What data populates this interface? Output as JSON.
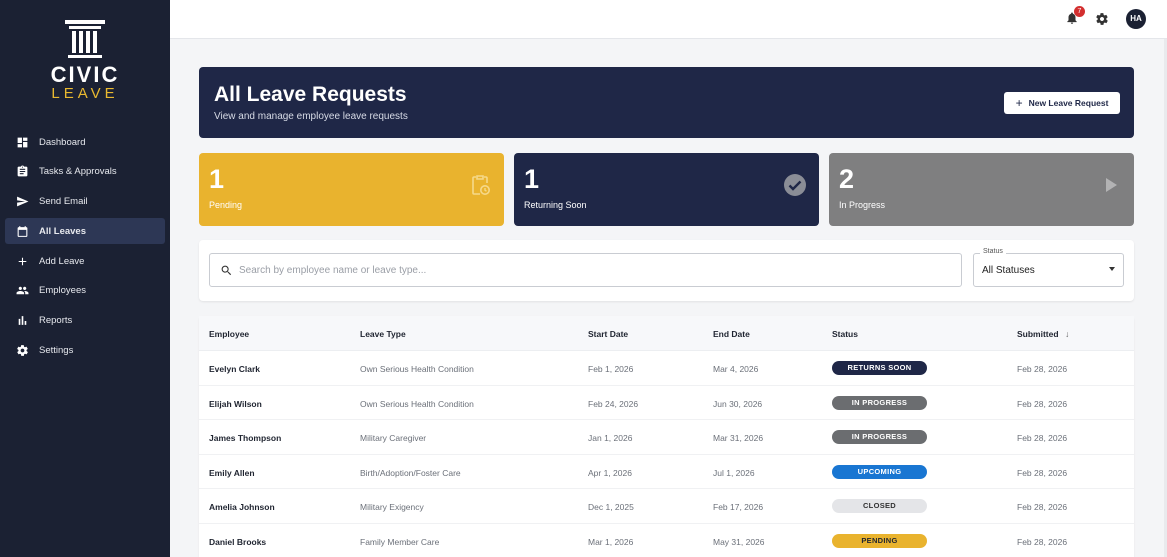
{
  "brand": {
    "name_top": "CIVIC",
    "name_bottom": "LEAVE",
    "accent": "#e9b930",
    "navy": "#1b2133"
  },
  "sidebar": {
    "items": [
      {
        "label": "Dashboard",
        "icon": "dashboard-icon"
      },
      {
        "label": "Tasks & Approvals",
        "icon": "clipboard-icon"
      },
      {
        "label": "Send Email",
        "icon": "send-icon"
      },
      {
        "label": "All Leaves",
        "icon": "calendar-icon",
        "active": true
      },
      {
        "label": "Add Leave",
        "icon": "plus-icon"
      },
      {
        "label": "Employees",
        "icon": "people-icon"
      },
      {
        "label": "Reports",
        "icon": "bar-chart-icon"
      },
      {
        "label": "Settings",
        "icon": "gear-icon"
      }
    ]
  },
  "topbar": {
    "notification_count": "7",
    "avatar_initials": "HA"
  },
  "header": {
    "title": "All Leave Requests",
    "subtitle": "View and manage employee leave requests",
    "new_button_label": "New Leave Request"
  },
  "stats": [
    {
      "value": "1",
      "label": "Pending",
      "color": "#e9b32e",
      "icon": "clipboard-clock-icon"
    },
    {
      "value": "1",
      "label": "Returning Soon",
      "color": "#1f2747",
      "icon": "check-circle-icon"
    },
    {
      "value": "2",
      "label": "In Progress",
      "color": "#7f7f80",
      "icon": "play-icon"
    }
  ],
  "filters": {
    "search_placeholder": "Search by employee name or leave type...",
    "status_label": "Status",
    "status_value": "All Statuses"
  },
  "table": {
    "columns": [
      "Employee",
      "Leave Type",
      "Start Date",
      "End Date",
      "Status",
      "Submitted"
    ],
    "sort_indicator": "↓",
    "rows": [
      {
        "employee": "Evelyn Clark",
        "leave_type": "Own Serious Health Condition",
        "start": "Feb 1, 2026",
        "end": "Mar 4, 2026",
        "status": "RETURNS SOON",
        "status_color": "#1f2747",
        "status_text_color": "#ffffff",
        "submitted": "Feb 28, 2026"
      },
      {
        "employee": "Elijah Wilson",
        "leave_type": "Own Serious Health Condition",
        "start": "Feb 24, 2026",
        "end": "Jun 30, 2026",
        "status": "IN PROGRESS",
        "status_color": "#6b6d70",
        "status_text_color": "#ffffff",
        "submitted": "Feb 28, 2026"
      },
      {
        "employee": "James Thompson",
        "leave_type": "Military Caregiver",
        "start": "Jan 1, 2026",
        "end": "Mar 31, 2026",
        "status": "IN PROGRESS",
        "status_color": "#6b6d70",
        "status_text_color": "#ffffff",
        "submitted": "Feb 28, 2026"
      },
      {
        "employee": "Emily Allen",
        "leave_type": "Birth/Adoption/Foster Care",
        "start": "Apr 1, 2026",
        "end": "Jul 1, 2026",
        "status": "UPCOMING",
        "status_color": "#1976d2",
        "status_text_color": "#ffffff",
        "submitted": "Feb 28, 2026"
      },
      {
        "employee": "Amelia Johnson",
        "leave_type": "Military Exigency",
        "start": "Dec 1, 2025",
        "end": "Feb 17, 2026",
        "status": "CLOSED",
        "status_color": "#e4e5e8",
        "status_text_color": "#333333",
        "submitted": "Feb 28, 2026"
      },
      {
        "employee": "Daniel Brooks",
        "leave_type": "Family Member Care",
        "start": "Mar 1, 2026",
        "end": "May 31, 2026",
        "status": "PENDING",
        "status_color": "#e9b32e",
        "status_text_color": "#1f2430",
        "submitted": "Feb 28, 2026"
      }
    ]
  }
}
